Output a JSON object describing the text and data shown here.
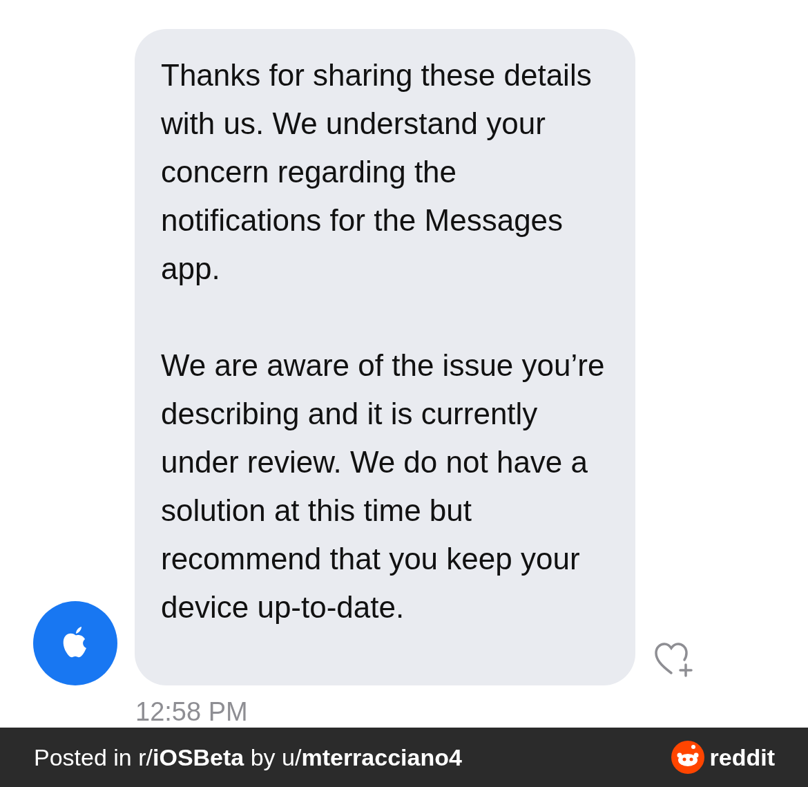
{
  "message": {
    "paragraphs": [
      "Thanks for sharing these details with us. We understand your concern regarding the notifications for the Messages app.",
      "We are aware of the issue you’re describing and it is currently under review. We do not have a solution at this time but recommend that you keep your device up-to-date."
    ],
    "time": "12:58 PM",
    "liked": false
  },
  "footer": {
    "caption": "Posted in r/**iOSBeta** by u/**mterracciano4**",
    "brand": "reddit"
  }
}
